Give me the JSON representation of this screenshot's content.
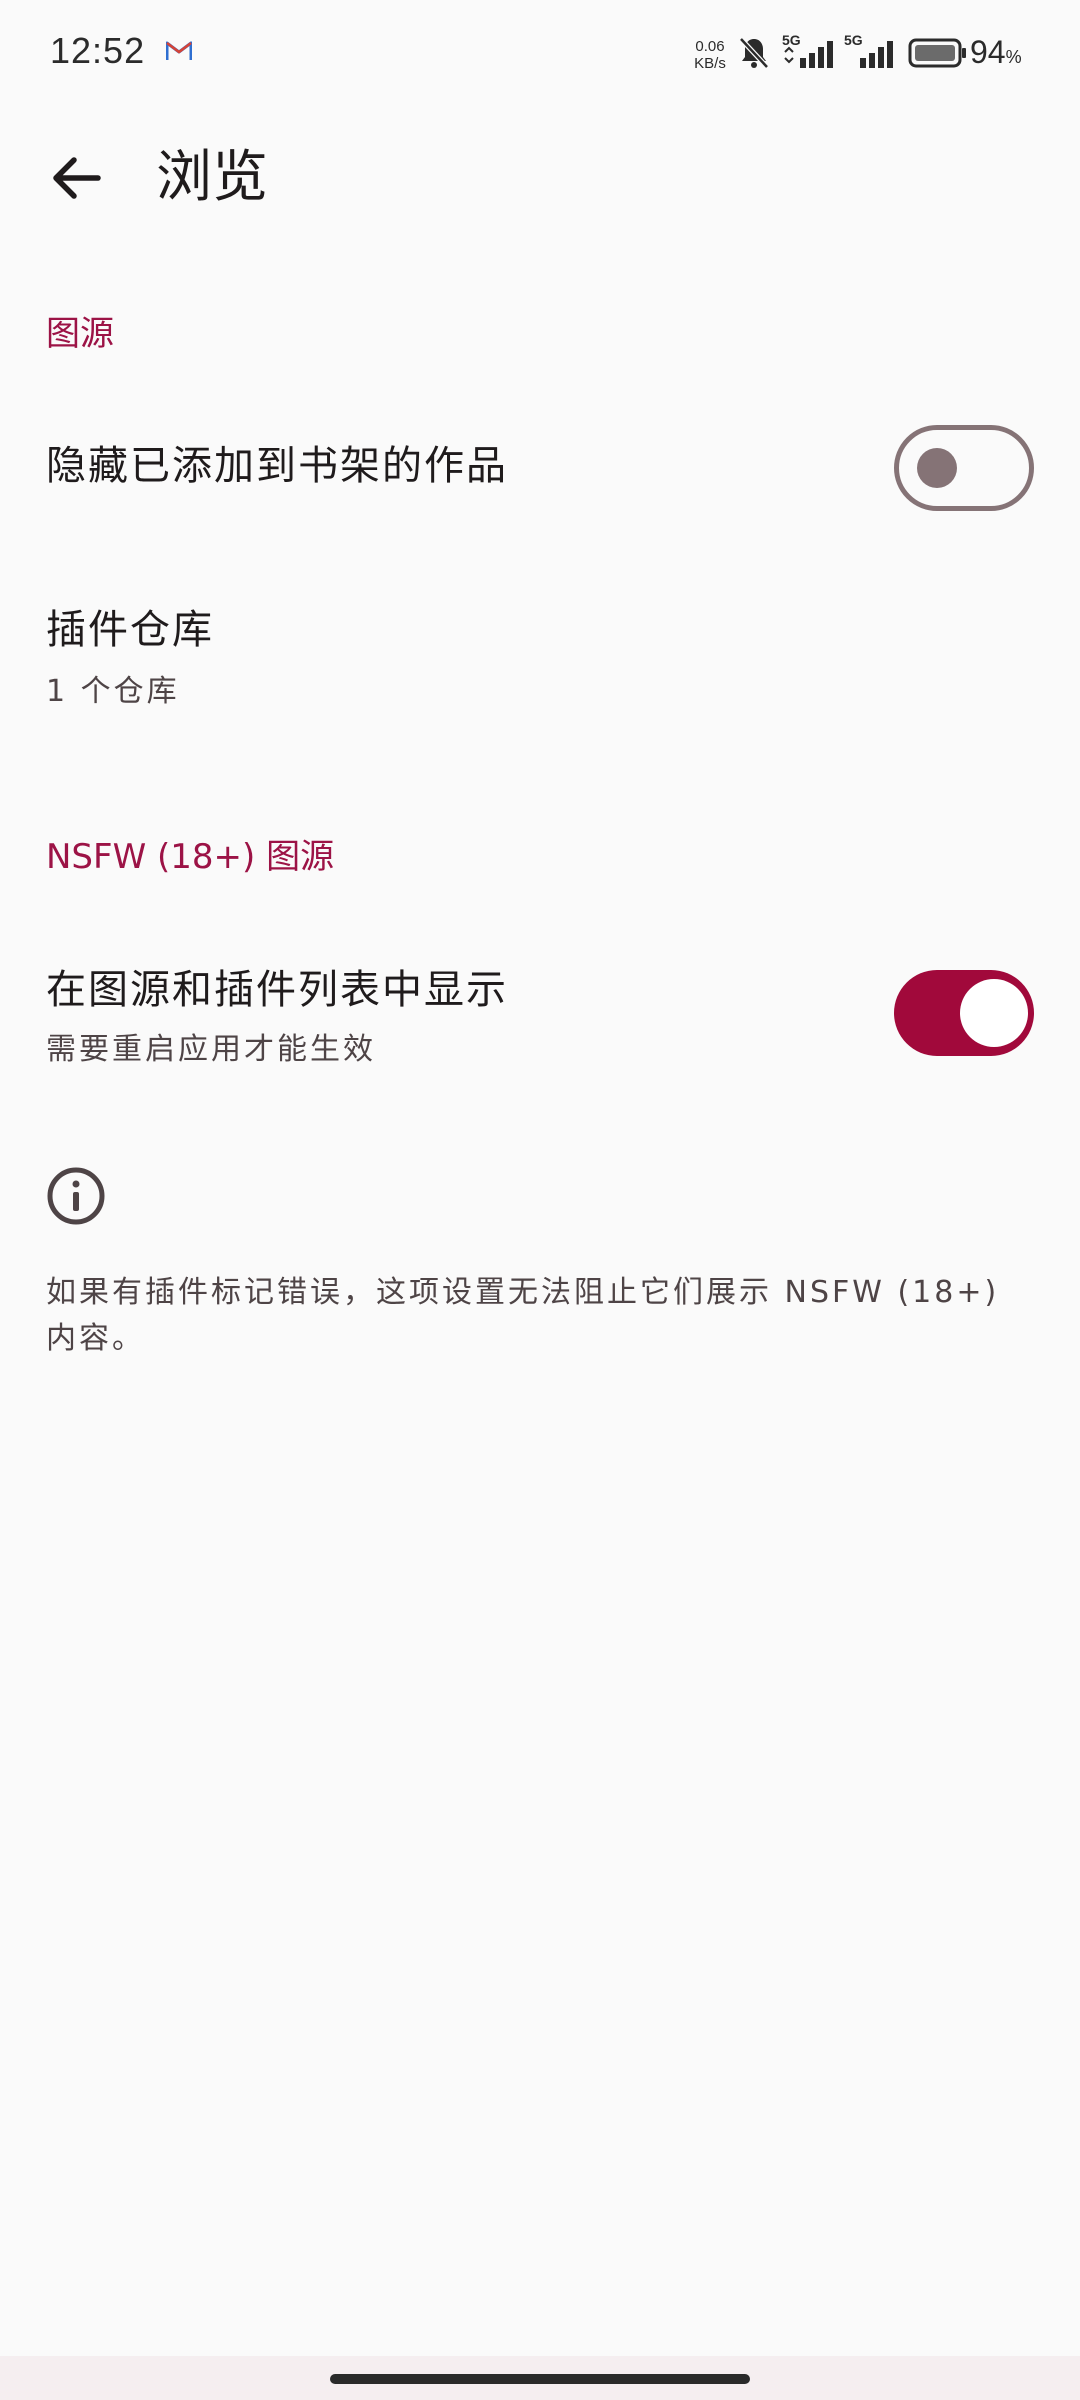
{
  "status_bar": {
    "time": "12:52",
    "net_speed_value": "0.06",
    "net_speed_unit": "KB/s",
    "signal_label": "5G",
    "battery_level": "94",
    "battery_unit": "%",
    "icons": [
      "gmail-icon",
      "bell-off-icon",
      "signal-5g-icon",
      "signal-5g-icon",
      "battery-icon"
    ]
  },
  "app_bar": {
    "title": "浏览",
    "back_icon": "arrow-back-icon"
  },
  "sections": {
    "sources": {
      "header": "图源",
      "hide_in_library": {
        "title": "隐藏已添加到书架的作品",
        "enabled": false
      },
      "extension_repos": {
        "title": "插件仓库",
        "summary": "1 个仓库"
      }
    },
    "nsfw": {
      "header": "NSFW (18+) 图源",
      "show_in_lists": {
        "title": "在图源和插件列表中显示",
        "summary": "需要重启应用才能生效",
        "enabled": true
      },
      "info_icon": "info-icon",
      "info_text": "如果有插件标记错误，这项设置无法阻止它们展示 NSFW (18+) 内容。"
    }
  },
  "colors": {
    "accent": "#9c1346",
    "switch_on_track": "#a1093b",
    "switch_off_outline": "#857376",
    "background": "#fafafa"
  }
}
